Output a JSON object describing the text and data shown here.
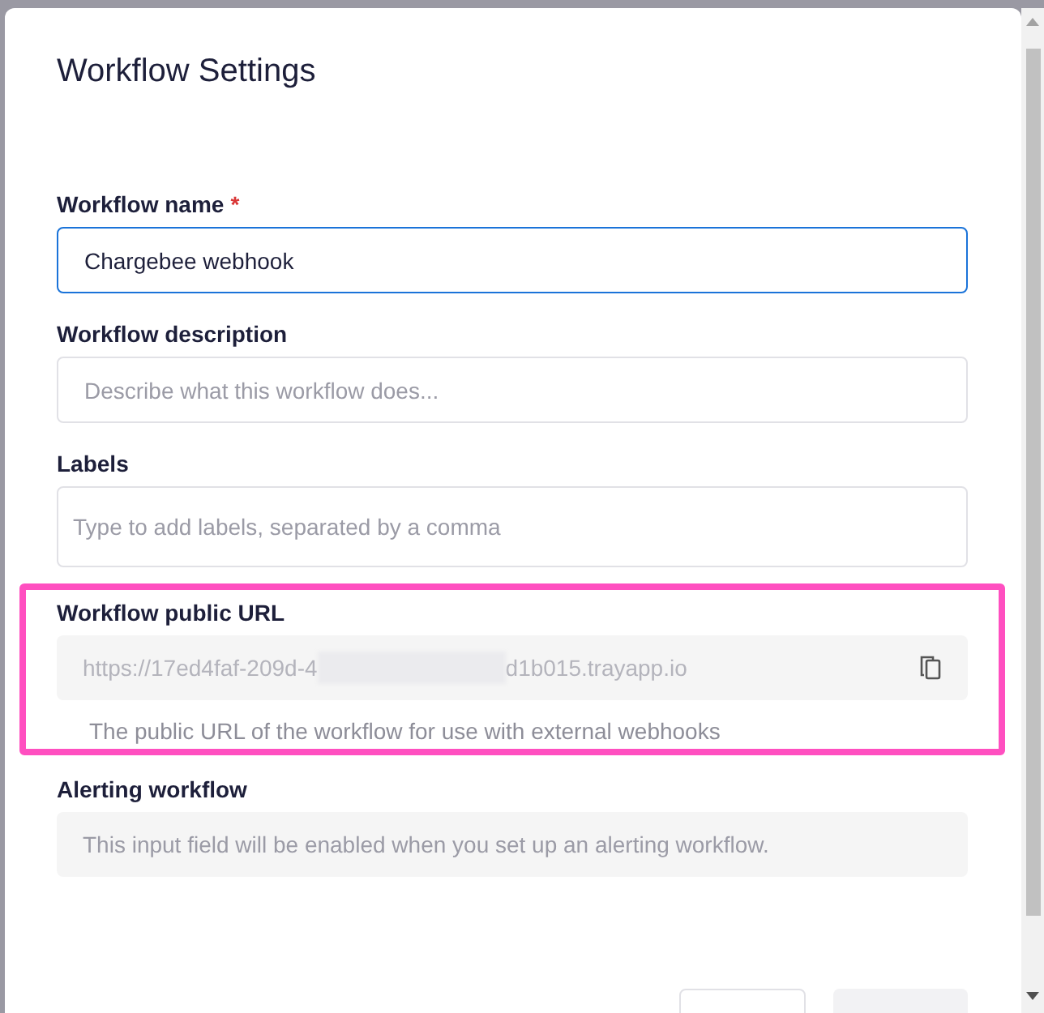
{
  "dialog": {
    "title": "Workflow Settings"
  },
  "fields": [
    {
      "kind": "input",
      "label": "Workflow name",
      "required_mark": "*",
      "value": "Chargebee webhook",
      "focused": true
    },
    {
      "kind": "input",
      "label": "Workflow description",
      "placeholder": "Describe what this workflow does...",
      "focused": false
    },
    {
      "kind": "tags",
      "label": "Labels",
      "placeholder": "Type to add labels, separated by a comma",
      "focused": false
    },
    {
      "kind": "url",
      "label": "Workflow public URL",
      "url_start": "https://17ed4faf-209d-4",
      "url_end": "d1b015.trayapp.io",
      "hint": "The public URL of the workflow for use with external webhooks",
      "highlighted": true
    },
    {
      "kind": "notice",
      "label": "Alerting workflow",
      "text": "This input field will be enabled when you set up an alerting workflow."
    }
  ],
  "footer_buttons": [
    {
      "kind": "outline"
    },
    {
      "kind": "filled"
    }
  ]
}
